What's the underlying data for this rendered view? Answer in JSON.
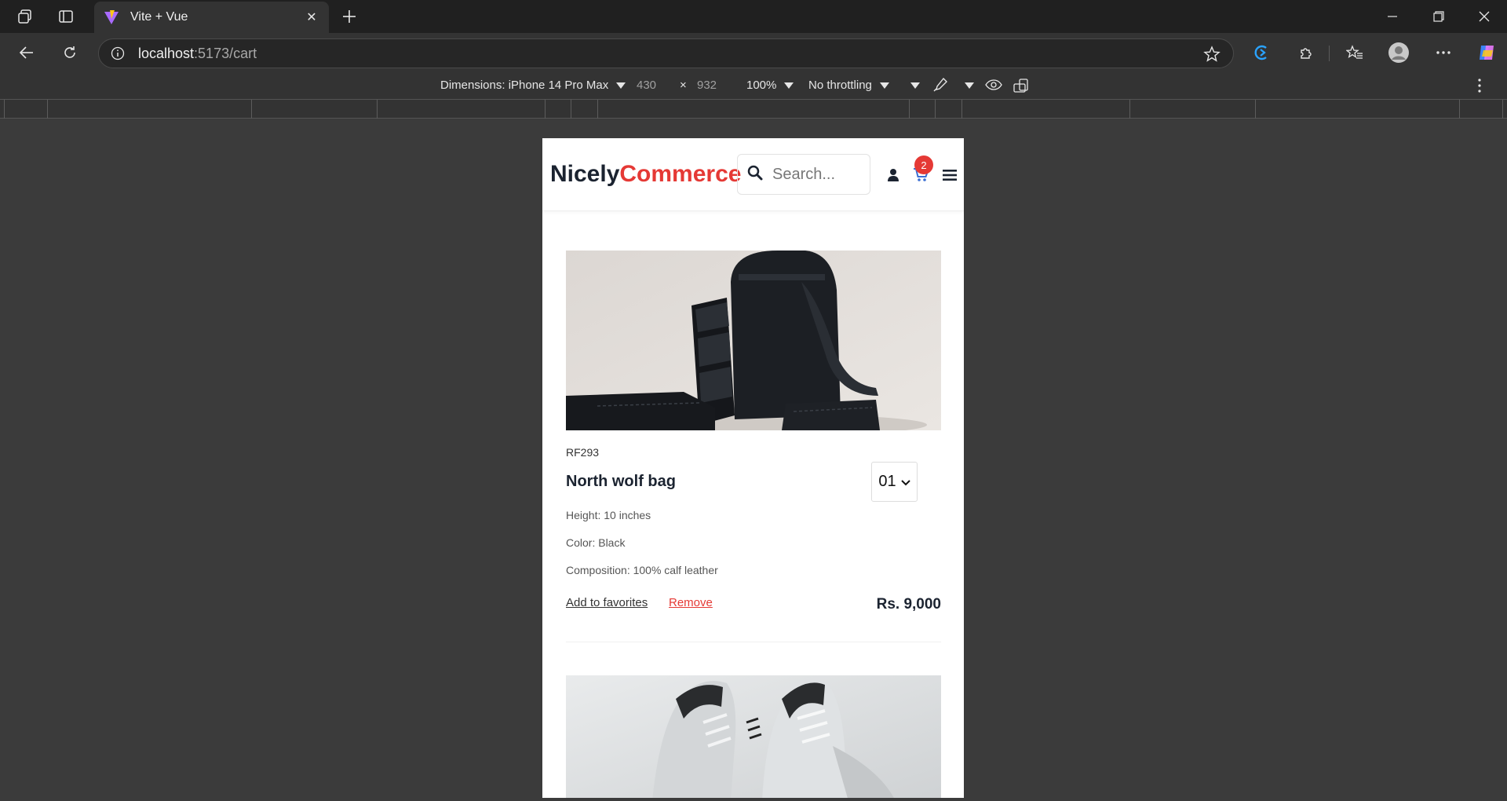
{
  "browser": {
    "tab_title": "Vite + Vue",
    "url_host": "localhost",
    "url_path": ":5173/cart"
  },
  "devtools": {
    "dimensions_label": "Dimensions: iPhone 14 Pro Max",
    "width": "430",
    "times": "×",
    "height": "932",
    "zoom": "100%",
    "throttling": "No throttling"
  },
  "site": {
    "logo_part1": "Nicely",
    "logo_part2": "Commerce",
    "search_placeholder": "Search...",
    "cart_count": "2"
  },
  "cart": {
    "items": [
      {
        "sku": "RF293",
        "name": "North wolf bag",
        "quantity": "01",
        "attributes": [
          "Height: 10 inches",
          "Color: Black",
          "Composition: 100% calf leather"
        ],
        "add_to_favorites": "Add to favorites",
        "remove": "Remove",
        "price": "Rs. 9,000"
      }
    ]
  },
  "colors": {
    "brand_dark": "#1b2330",
    "brand_red": "#e53935"
  }
}
